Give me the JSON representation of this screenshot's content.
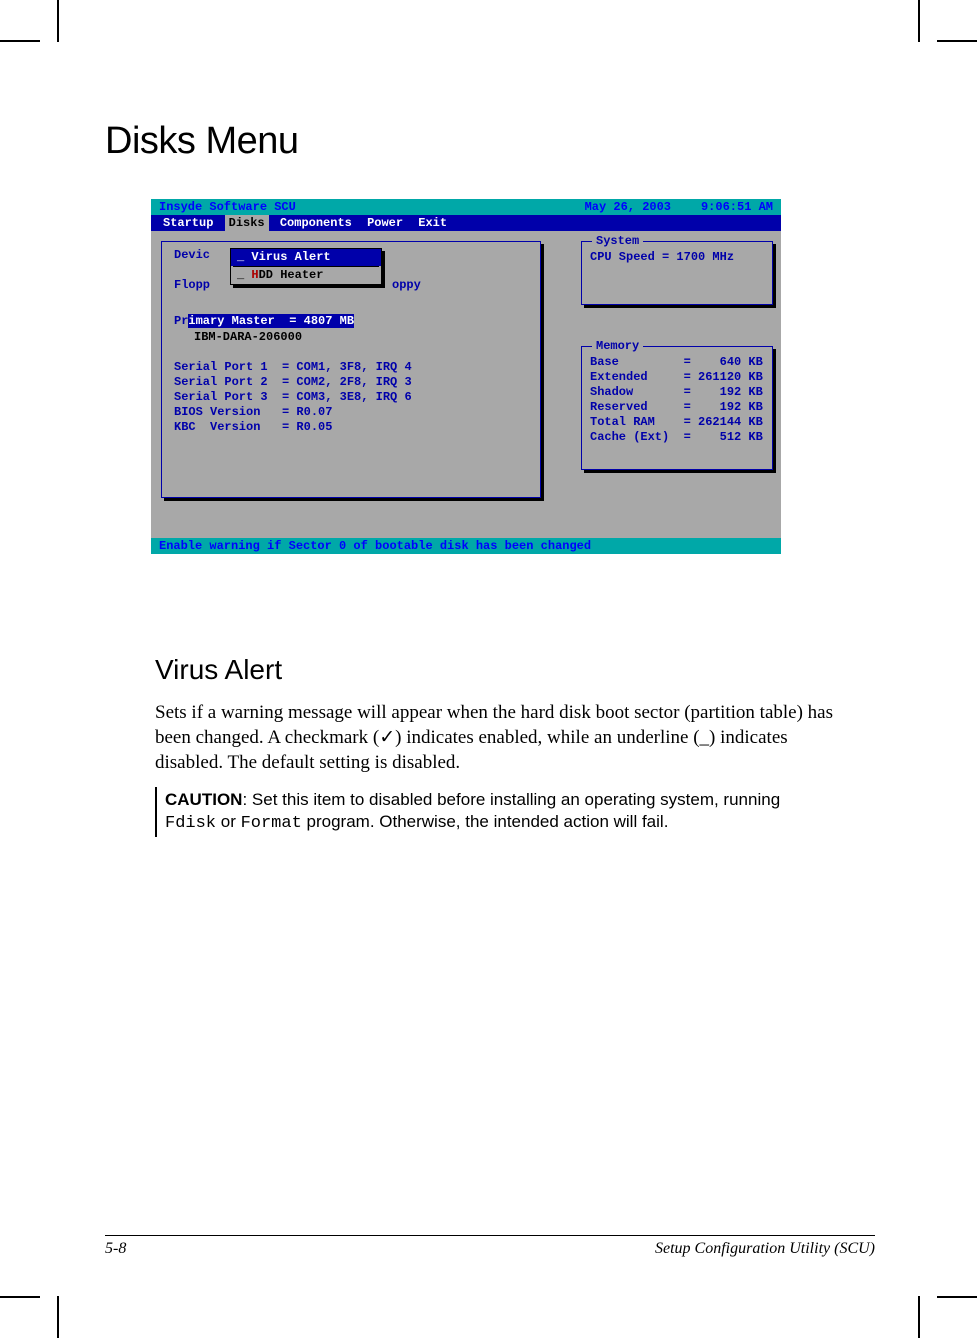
{
  "page": {
    "title": "Disks Menu",
    "footer_left": "5-8",
    "footer_right": "Setup Configuration Utility (SCU)"
  },
  "scu": {
    "titlebar": {
      "product": "Insyde Software SCU",
      "date": "May 26, 2003",
      "time": "9:06:51 AM"
    },
    "menubar": {
      "items": [
        "Startup",
        "Disks",
        "Components",
        "Power",
        "Exit"
      ],
      "selected": "Disks"
    },
    "dropdown": {
      "items": [
        {
          "prefix": "_ ",
          "hot": "V",
          "rest": "irus Alert",
          "selected": true
        },
        {
          "prefix": "_ ",
          "hot": "H",
          "rest": "DD Heater",
          "selected": false
        }
      ]
    },
    "devices": {
      "label": "Devic",
      "floppy_label": "Flopp",
      "floppy_trail": "oppy",
      "primary_prefix": "Pr",
      "primary_hl": "imary Master  = 4807 MB",
      "ibm": "IBM-DARA-206000",
      "rows": [
        "Serial Port 1  = COM1, 3F8, IRQ 4",
        "Serial Port 2  = COM2, 2F8, IRQ 3",
        "Serial Port 3  = COM3, 3E8, IRQ 6",
        "BIOS Version   = R0.07",
        "KBC  Version   = R0.05"
      ]
    },
    "system": {
      "label": "System",
      "cpu": "CPU Speed = 1700 MHz"
    },
    "memory": {
      "label": "Memory",
      "rows": [
        "Base         =    640 KB",
        "Extended     = 261120 KB",
        "Shadow       =    192 KB",
        "Reserved     =    192 KB",
        "Total RAM    = 262144 KB",
        "Cache (Ext)  =    512 KB"
      ]
    },
    "status": "Enable warning if Sector 0 of bootable disk has been changed"
  },
  "section": {
    "heading": "Virus Alert",
    "body": "Sets if a warning message will appear when the hard disk boot sector (partition table) has been changed. A checkmark (✓) indicates enabled, while an underline (_) indicates disabled. The default setting is disabled.",
    "caution_label": "CAUTION",
    "caution_1": ": Set this item to disabled before installing an operating system, running ",
    "caution_fdisk": "Fdisk",
    "caution_or": " or ",
    "caution_format": "Format",
    "caution_2": " program. Otherwise, the intended action will fail."
  }
}
